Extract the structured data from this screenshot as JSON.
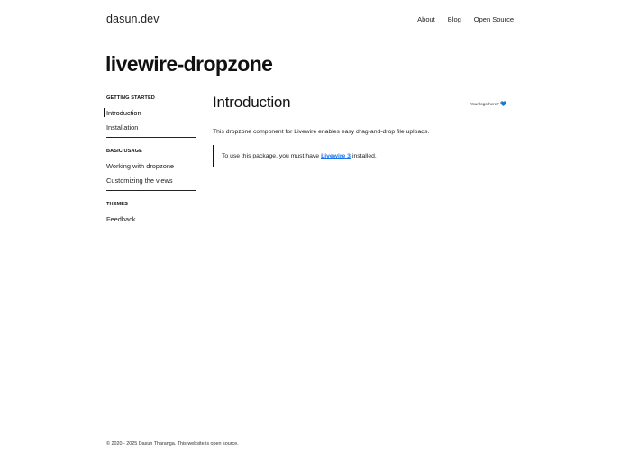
{
  "site": {
    "logo": "dasun.dev"
  },
  "nav": {
    "items": [
      "About",
      "Blog",
      "Open Source"
    ]
  },
  "project": {
    "title": "livewire-dropzone"
  },
  "sidebar": {
    "sections": [
      {
        "heading": "GETTING STARTED",
        "items": [
          "Introduction",
          "Installation"
        ]
      },
      {
        "heading": "BASIC USAGE",
        "items": [
          "Working with dropzone",
          "Customizing the views"
        ]
      },
      {
        "heading": "THEMES",
        "items": [
          "Feedback"
        ]
      }
    ],
    "active": "Introduction"
  },
  "main": {
    "title": "Introduction",
    "intro": "This dropzone component for Livewire enables easy drag-and-drop file uploads.",
    "callout_before": "To use this package, you must have",
    "callout_link": "Livewire 3",
    "callout_after": "installed."
  },
  "ad": {
    "label": "Your logo here?",
    "icon": "heart-icon",
    "icon_color": "#3b8fe6"
  },
  "footer": {
    "text": "© 2020 - 2025 Dasun Tharanga. This website is open source."
  }
}
